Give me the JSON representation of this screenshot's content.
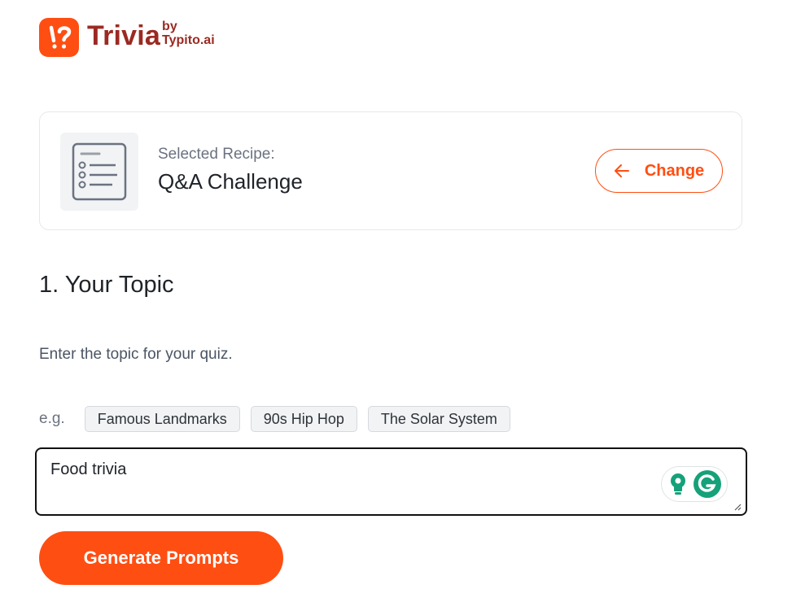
{
  "header": {
    "logo_mark": "!?",
    "logo_word": "Trivia",
    "logo_by": "by",
    "logo_brand": "Typito.ai"
  },
  "recipe": {
    "caption": "Selected Recipe:",
    "name": "Q&A Challenge",
    "thumb_icon": "checklist-icon",
    "change_label": "Change",
    "change_icon": "arrow-left-icon"
  },
  "topic": {
    "title": "1. Your Topic",
    "description": "Enter the topic for your quiz.",
    "eg_label": "e.g.",
    "examples": [
      "Famous Landmarks",
      "90s Hip Hop",
      "The Solar System"
    ],
    "value": "Food trivia"
  },
  "actions": {
    "generate_label": "Generate Prompts"
  },
  "colors": {
    "accent": "#ff4e12",
    "brand_text": "#9b2a22",
    "grammarly_green": "#15a179"
  }
}
